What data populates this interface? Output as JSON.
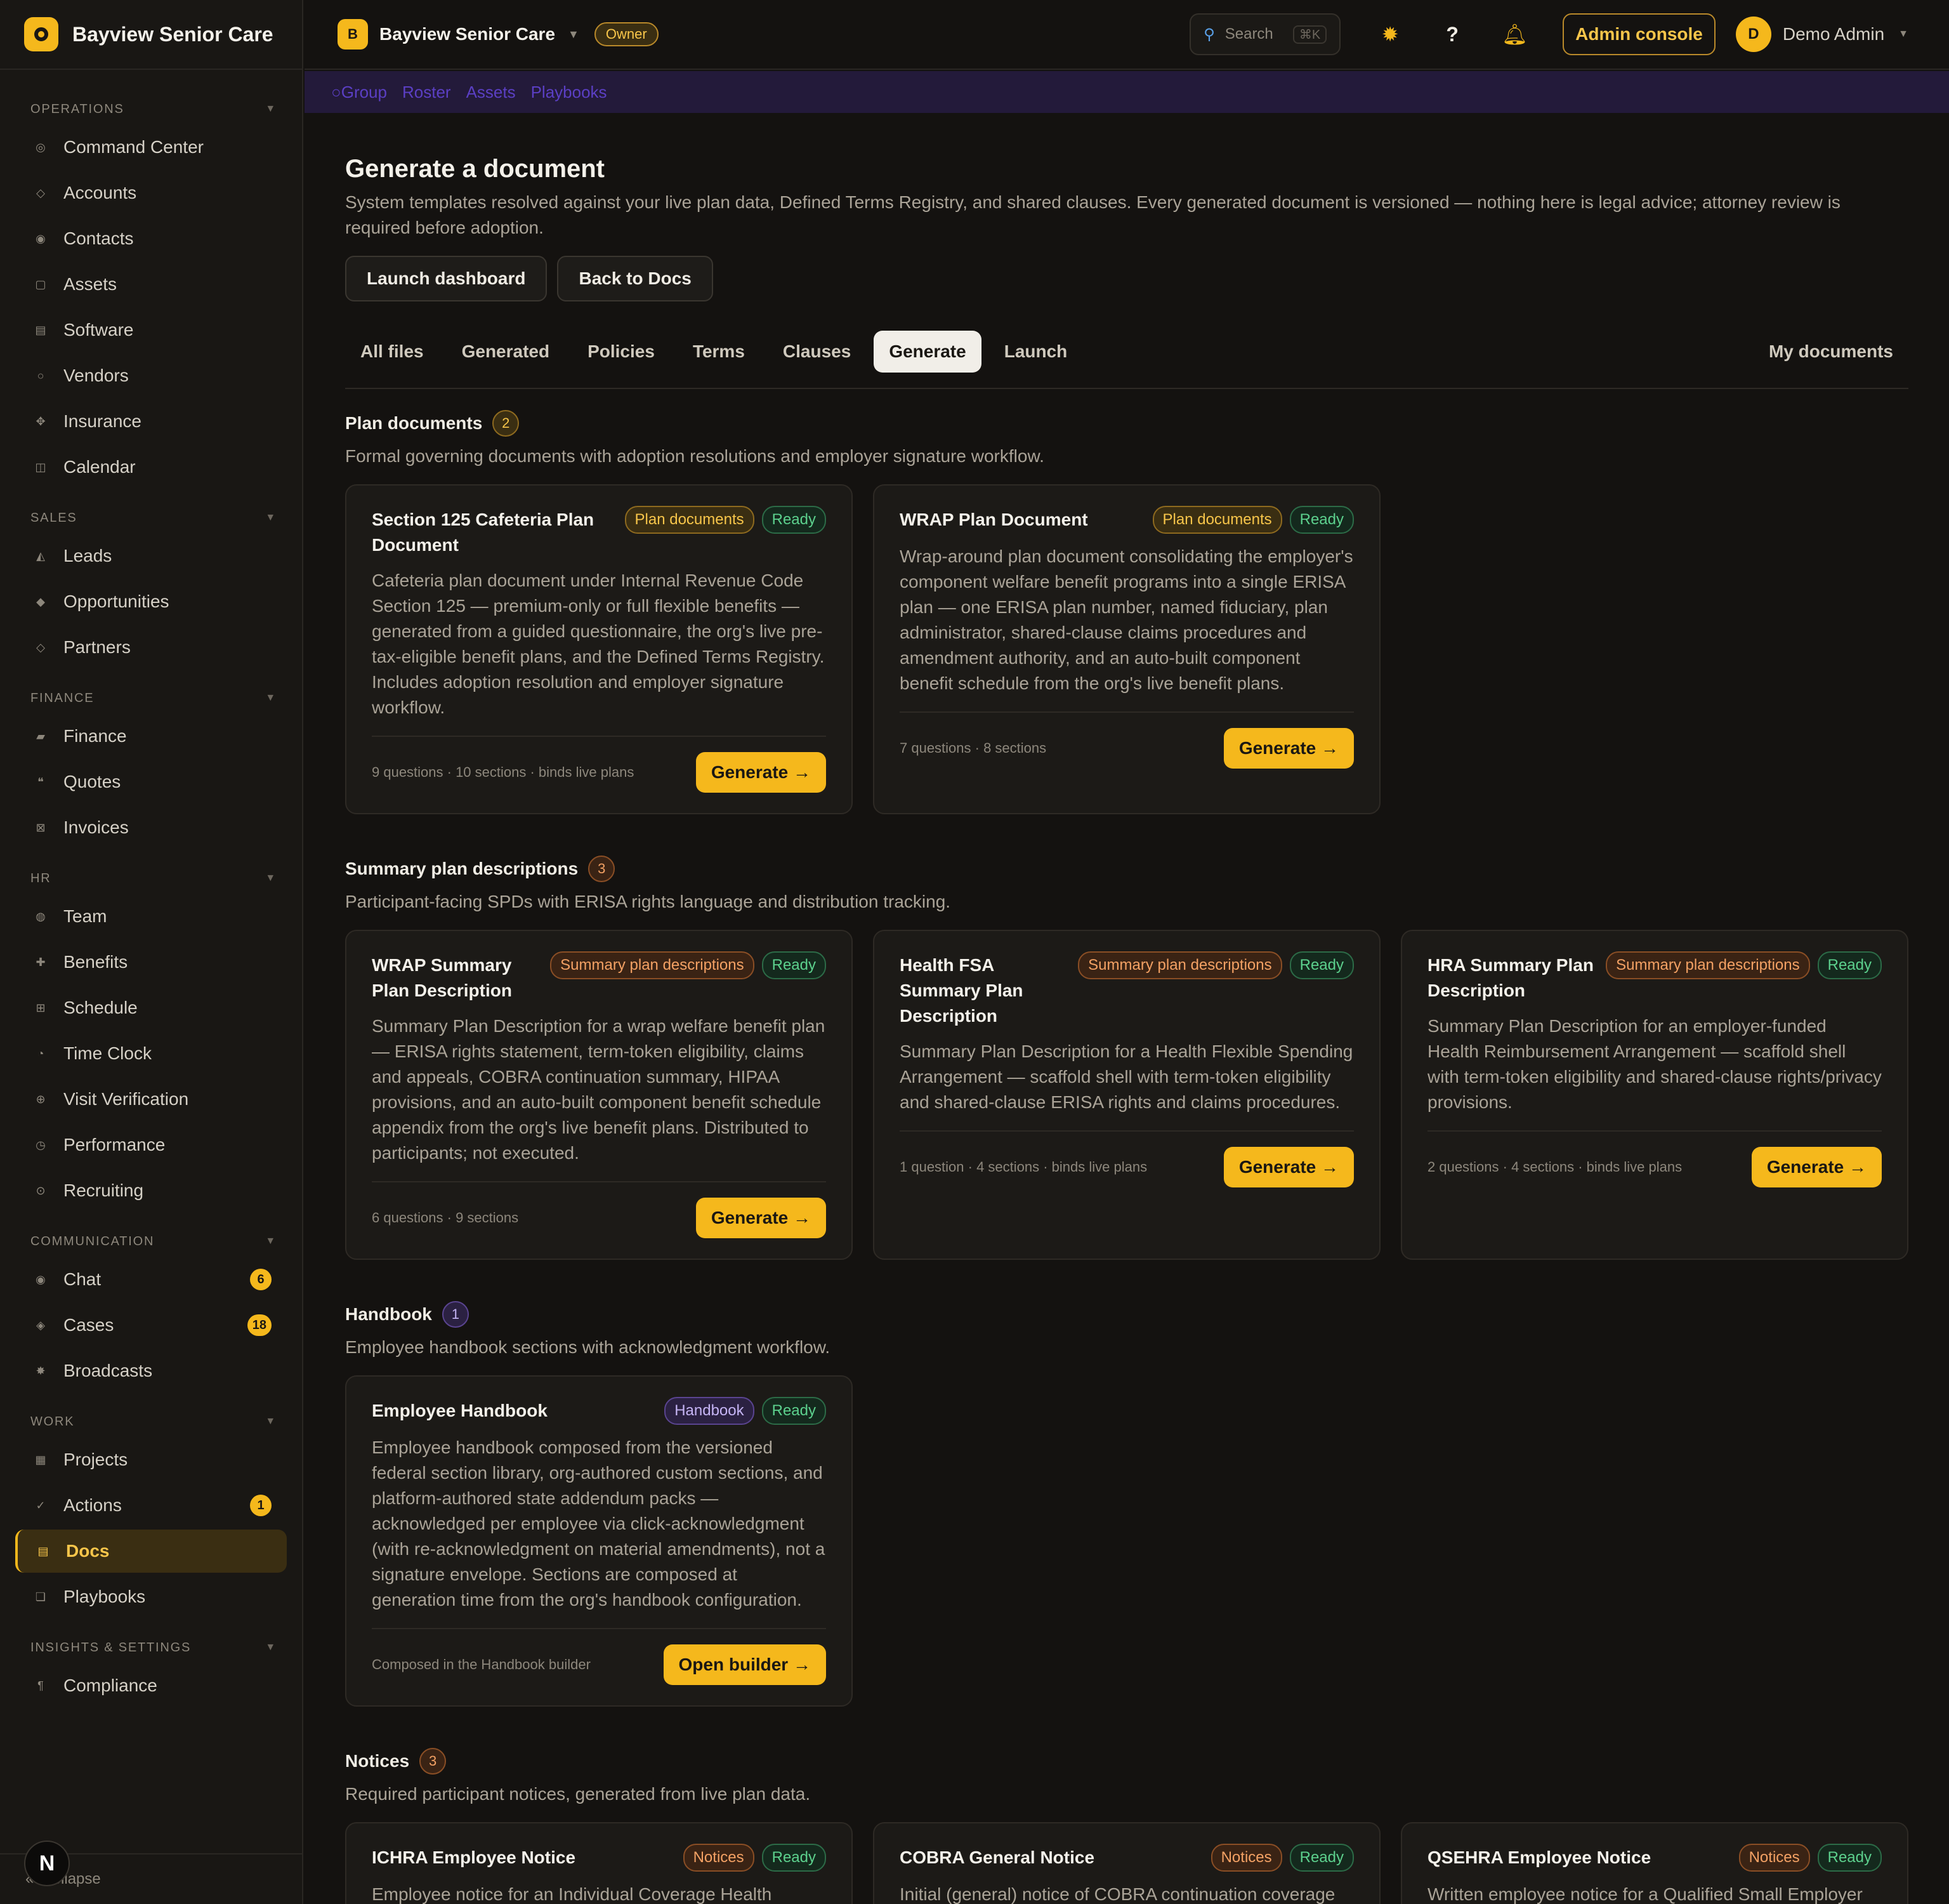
{
  "app": {
    "brand": "Bayview Senior Care",
    "org_name": "Bayview Senior Care",
    "org_initial": "B",
    "role_badge": "Owner",
    "search_placeholder": "Search",
    "search_shortcut": "⌘K",
    "admin_console": "Admin console",
    "user_initial": "D",
    "user_name": "Demo Admin",
    "collapse": "Collapse",
    "n_logo": "N"
  },
  "strip": [
    "Group",
    "Roster",
    "Assets",
    "Playbooks"
  ],
  "sidebar": {
    "sections": [
      {
        "title": "OPERATIONS",
        "items": [
          {
            "label": "Command Center",
            "icon": "◎"
          },
          {
            "label": "Accounts",
            "icon": "◇"
          },
          {
            "label": "Contacts",
            "icon": "◉"
          },
          {
            "label": "Assets",
            "icon": "▢"
          },
          {
            "label": "Software",
            "icon": "▤"
          },
          {
            "label": "Vendors",
            "icon": "○"
          },
          {
            "label": "Insurance",
            "icon": "✥"
          },
          {
            "label": "Calendar",
            "icon": "◫"
          }
        ]
      },
      {
        "title": "SALES",
        "items": [
          {
            "label": "Leads",
            "icon": "◭"
          },
          {
            "label": "Opportunities",
            "icon": "◆"
          },
          {
            "label": "Partners",
            "icon": "◇"
          }
        ]
      },
      {
        "title": "FINANCE",
        "items": [
          {
            "label": "Finance",
            "icon": "▰"
          },
          {
            "label": "Quotes",
            "icon": "❝"
          },
          {
            "label": "Invoices",
            "icon": "⊠"
          }
        ]
      },
      {
        "title": "HR",
        "items": [
          {
            "label": "Team",
            "icon": "◍"
          },
          {
            "label": "Benefits",
            "icon": "✚"
          },
          {
            "label": "Schedule",
            "icon": "⊞"
          },
          {
            "label": "Time Clock",
            "icon": "◔"
          },
          {
            "label": "Visit Verification",
            "icon": "⊕"
          },
          {
            "label": "Performance",
            "icon": "◷"
          },
          {
            "label": "Recruiting",
            "icon": "⊙"
          }
        ]
      },
      {
        "title": "COMMUNICATION",
        "items": [
          {
            "label": "Chat",
            "icon": "◉",
            "badge": "6"
          },
          {
            "label": "Cases",
            "icon": "◈",
            "badge": "18"
          },
          {
            "label": "Broadcasts",
            "icon": "✸"
          }
        ]
      },
      {
        "title": "WORK",
        "items": [
          {
            "label": "Projects",
            "icon": "▦"
          },
          {
            "label": "Actions",
            "icon": "✓",
            "badge": "1"
          },
          {
            "label": "Docs",
            "icon": "▤",
            "active": true
          },
          {
            "label": "Playbooks",
            "icon": "❏"
          }
        ]
      },
      {
        "title": "INSIGHTS & SETTINGS",
        "items": [
          {
            "label": "Compliance",
            "icon": "¶"
          }
        ]
      }
    ]
  },
  "page": {
    "title": "Generate a document",
    "description": "System templates resolved against your live plan data, Defined Terms Registry, and shared clauses. Every generated document is versioned — nothing here is legal advice; attorney review is required before adoption.",
    "buttons": [
      "Launch dashboard",
      "Back to Docs"
    ],
    "tabs": [
      "All files",
      "Generated",
      "Policies",
      "Terms",
      "Clauses",
      "Generate",
      "Launch"
    ],
    "active_tab": "Generate",
    "right_tab": "My documents"
  },
  "sections": [
    {
      "title": "Plan documents",
      "count": "2",
      "tone": "amber",
      "description": "Formal governing documents with adoption resolutions and employer signature workflow.",
      "cards": [
        {
          "title": "Section 125 Cafeteria Plan Document",
          "category": "Plan documents",
          "status": "Ready",
          "description": "Cafeteria plan document under Internal Revenue Code Section 125 — premium-only or full flexible benefits — generated from a guided questionnaire, the org's live pre-tax-eligible benefit plans, and the Defined Terms Registry. Includes adoption resolution and employer signature workflow.",
          "meta": "9 questions · 10 sections · binds live plans",
          "action": "Generate →"
        },
        {
          "title": "WRAP Plan Document",
          "category": "Plan documents",
          "status": "Ready",
          "description": "Wrap-around plan document consolidating the employer's component welfare benefit programs into a single ERISA plan — one ERISA plan number, named fiduciary, plan administrator, shared-clause claims procedures and amendment authority, and an auto-built component benefit schedule from the org's live benefit plans.",
          "meta": "7 questions · 8 sections",
          "action": "Generate →"
        }
      ]
    },
    {
      "title": "Summary plan descriptions",
      "count": "3",
      "tone": "orange",
      "description": "Participant-facing SPDs with ERISA rights language and distribution tracking.",
      "cards": [
        {
          "title": "WRAP Summary Plan Description",
          "category": "Summary plan descriptions",
          "status": "Ready",
          "description": "Summary Plan Description for a wrap welfare benefit plan — ERISA rights statement, term-token eligibility, claims and appeals, COBRA continuation summary, HIPAA provisions, and an auto-built component benefit schedule appendix from the org's live benefit plans. Distributed to participants; not executed.",
          "meta": "6 questions · 9 sections",
          "action": "Generate →"
        },
        {
          "title": "Health FSA Summary Plan Description",
          "category": "Summary plan descriptions",
          "status": "Ready",
          "description": "Summary Plan Description for a Health Flexible Spending Arrangement — scaffold shell with term-token eligibility and shared-clause ERISA rights and claims procedures.",
          "meta": "1 question · 4 sections · binds live plans",
          "action": "Generate →"
        },
        {
          "title": "HRA Summary Plan Description",
          "category": "Summary plan descriptions",
          "status": "Ready",
          "description": "Summary Plan Description for an employer-funded Health Reimbursement Arrangement — scaffold shell with term-token eligibility and shared-clause rights/privacy provisions.",
          "meta": "2 questions · 4 sections · binds live plans",
          "action": "Generate →"
        }
      ]
    },
    {
      "title": "Handbook",
      "count": "1",
      "tone": "purple",
      "description": "Employee handbook sections with acknowledgment workflow.",
      "cards": [
        {
          "title": "Employee Handbook",
          "category": "Handbook",
          "status": "Ready",
          "description": "Employee handbook composed from the versioned federal section library, org-authored custom sections, and platform-authored state addendum packs — acknowledged per employee via click-acknowledgment (with re-acknowledgment on material amendments), not a signature envelope. Sections are composed at generation time from the org's handbook configuration.",
          "meta": "Composed in the Handbook builder",
          "action": "Open builder →"
        }
      ]
    },
    {
      "title": "Notices",
      "count": "3",
      "tone": "orange",
      "description": "Required participant notices, generated from live plan data.",
      "cards": [
        {
          "title": "ICHRA Employee Notice",
          "category": "Notices",
          "status": "Ready",
          "description": "Employee notice for an Individual Coverage Health",
          "meta": "",
          "action": ""
        },
        {
          "title": "COBRA General Notice",
          "category": "Notices",
          "status": "Ready",
          "description": "Initial (general) notice of COBRA continuation coverage",
          "meta": "",
          "action": ""
        },
        {
          "title": "QSEHRA Employee Notice",
          "category": "Notices",
          "status": "Ready",
          "description": "Written employee notice for a Qualified Small Employer",
          "meta": "",
          "action": ""
        }
      ]
    }
  ],
  "colors": {
    "accent": "#f5b81c",
    "ready": "#5cd08d",
    "background": "#141210"
  }
}
